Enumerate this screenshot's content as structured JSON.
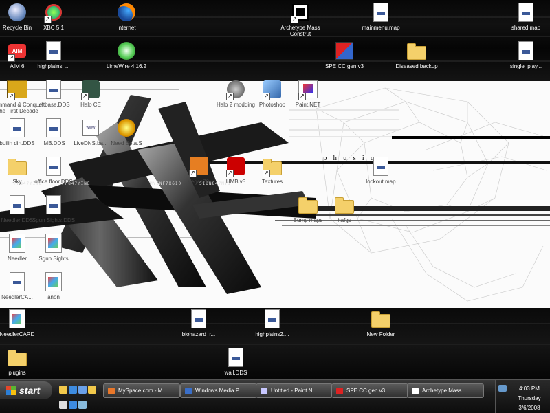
{
  "desktop": {
    "wallpaper_text": "phusio",
    "icons": [
      {
        "label": "Recycle Bin",
        "kind": "bin",
        "theme": "dark",
        "icon": "recycle-bin-icon"
      },
      {
        "label": "XBC 5.1",
        "kind": "xbc",
        "theme": "dark",
        "shortcut": true,
        "icon": "xbc-icon"
      },
      {
        "label": "Internet",
        "kind": "ff",
        "theme": "dark",
        "icon": "firefox-icon"
      },
      {
        "label": "Archetype Mass Construt",
        "kind": "arch",
        "theme": "dark",
        "shortcut": true,
        "icon": "archetype-icon"
      },
      {
        "label": "mainmenu.map",
        "kind": "doc",
        "theme": "dark",
        "icon": "map-file-icon"
      },
      {
        "label": "shared.map",
        "kind": "doc",
        "theme": "dark",
        "icon": "map-file-icon"
      },
      {
        "label": "AIM 6",
        "kind": "aim",
        "theme": "dark",
        "shortcut": true,
        "icon": "aim-icon"
      },
      {
        "label": "highplains_...",
        "kind": "doc",
        "theme": "dark",
        "icon": "dds-file-icon"
      },
      {
        "label": "LimeWire 4.16.2",
        "kind": "lime",
        "theme": "dark",
        "icon": "limewire-icon"
      },
      {
        "label": "SPE CC gen v3",
        "kind": "spe",
        "theme": "dark",
        "icon": "spe-icon"
      },
      {
        "label": "Diseased backup",
        "kind": "folder",
        "theme": "dark",
        "icon": "folder-icon"
      },
      {
        "label": "single_play...",
        "kind": "doc",
        "theme": "dark",
        "icon": "map-file-icon"
      },
      {
        "label": "Command & Conquer The First Decade",
        "kind": "cc",
        "theme": "light",
        "shortcut": true,
        "icon": "cnc-icon"
      },
      {
        "label": "Liftbase.DDS",
        "kind": "doc",
        "theme": "light",
        "icon": "dds-file-icon"
      },
      {
        "label": "Halo CE",
        "kind": "mc",
        "theme": "light",
        "shortcut": true,
        "icon": "halo-icon"
      },
      {
        "label": "Halo 2 modding",
        "kind": "halo2",
        "theme": "light",
        "shortcut": true,
        "icon": "halo2-icon"
      },
      {
        "label": "Photoshop",
        "kind": "ps",
        "theme": "light",
        "shortcut": true,
        "icon": "photoshop-icon"
      },
      {
        "label": "Paint.NET",
        "kind": "pnet",
        "theme": "light",
        "shortcut": true,
        "icon": "paintnet-icon"
      },
      {
        "label": "builin dirt.DDS",
        "kind": "doc",
        "theme": "light",
        "icon": "dds-file-icon"
      },
      {
        "label": "IMB.DDS",
        "kind": "doc",
        "theme": "light",
        "icon": "dds-file-icon"
      },
      {
        "label": "LiveDNS.ba...",
        "kind": "www",
        "theme": "light",
        "icon": "web-file-icon"
      },
      {
        "label": "Need Beta.S",
        "kind": "gold",
        "theme": "light",
        "icon": "needbeta-icon"
      },
      {
        "label": "Sky",
        "kind": "folder",
        "theme": "light",
        "icon": "folder-icon"
      },
      {
        "label": "office floor.DDS",
        "kind": "doc",
        "theme": "light",
        "icon": "dds-file-icon"
      },
      {
        "label": "vegas70",
        "kind": "vegas",
        "theme": "light",
        "shortcut": true,
        "icon": "vegas-icon"
      },
      {
        "label": "UMB v5",
        "kind": "umb",
        "theme": "light",
        "shortcut": true,
        "icon": "umb-icon"
      },
      {
        "label": "Textures",
        "kind": "folder",
        "theme": "light",
        "shortcut": true,
        "icon": "folder-icon"
      },
      {
        "label": "lockout.map",
        "kind": "doc",
        "theme": "light",
        "icon": "map-file-icon"
      },
      {
        "label": "Needler.DDS",
        "kind": "doc",
        "theme": "light",
        "icon": "dds-file-icon"
      },
      {
        "label": "Sgun Sights.DDS",
        "kind": "doc",
        "theme": "light",
        "icon": "dds-file-icon"
      },
      {
        "label": "Bump maps",
        "kind": "folder",
        "theme": "light",
        "icon": "folder-icon"
      },
      {
        "label": "hafgs",
        "kind": "folder",
        "theme": "light",
        "icon": "folder-icon"
      },
      {
        "label": "Needler",
        "kind": "paint",
        "theme": "light",
        "icon": "image-file-icon"
      },
      {
        "label": "Sgun Sights",
        "kind": "paint",
        "theme": "light",
        "icon": "image-file-icon"
      },
      {
        "label": "NeedlerCA...",
        "kind": "doc",
        "theme": "light",
        "icon": "dds-file-icon"
      },
      {
        "label": "anon",
        "kind": "paint",
        "theme": "light",
        "icon": "image-file-icon"
      },
      {
        "label": "NeedlerCARD",
        "kind": "paint",
        "theme": "dark",
        "icon": "image-file-icon"
      },
      {
        "label": "biohazard_r...",
        "kind": "doc",
        "theme": "dark",
        "icon": "dds-file-icon"
      },
      {
        "label": "highplains2....",
        "kind": "doc",
        "theme": "dark",
        "icon": "dds-file-icon"
      },
      {
        "label": "New Folder",
        "kind": "folder",
        "theme": "dark",
        "icon": "folder-icon"
      },
      {
        "label": "plugins",
        "kind": "folder",
        "theme": "dark",
        "icon": "folder-icon"
      },
      {
        "label": "wall.DDS",
        "kind": "doc",
        "theme": "dark",
        "icon": "dds-file-icon"
      }
    ]
  },
  "taskbar": {
    "start_label": "start",
    "quick_launch": [
      "folder-icon",
      "ie-icon",
      "media-icon",
      "folder-icon",
      "doc-icon",
      "ie-icon",
      "media-icon"
    ],
    "buttons": [
      {
        "label": "MySpace.com - M...",
        "icon": "firefox-icon",
        "color": "#e8772a"
      },
      {
        "label": "Windows Media P...",
        "icon": "media-player-icon",
        "color": "#3a6fc9"
      },
      {
        "label": "Untitled - Paint.N...",
        "icon": "paintnet-icon",
        "color": "#c8c8ff"
      },
      {
        "label": "SPE CC gen v3",
        "icon": "spe-icon",
        "color": "#d22"
      },
      {
        "label": "Archetype Mass ...",
        "icon": "archetype-icon",
        "color": "#fff"
      }
    ],
    "tray": {
      "time": "4:03 PM",
      "day": "Thursday",
      "date": "3/6/2008"
    }
  }
}
